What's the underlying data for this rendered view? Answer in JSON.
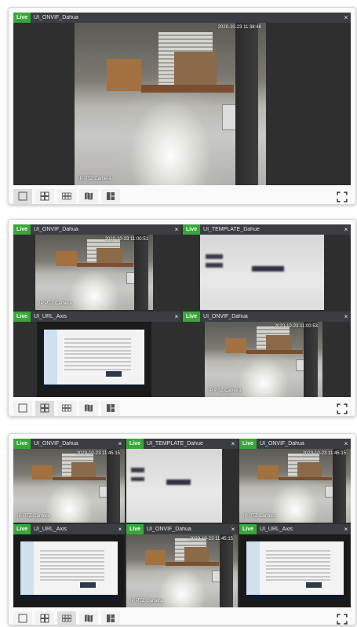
{
  "panels": [
    {
      "tiles": [
        {
          "live": "Live",
          "title": "UI_ONVIF_Dahua",
          "close": "×",
          "timestamp": "2020-10-23 11:38:48",
          "caption": "IP PTZ Camera"
        }
      ]
    },
    {
      "tiles": [
        {
          "live": "Live",
          "title": "UI_ONVIF_Dahua",
          "close": "×",
          "timestamp": "2020-10-23 11:00:51",
          "caption": "IP PTZ Camera"
        },
        {
          "live": "Live",
          "title": "UI_TEMPLATE_Dahue",
          "close": "×",
          "timestamp": "",
          "caption": ""
        },
        {
          "live": "Live",
          "title": "UI_URL_Axis",
          "close": "×",
          "timestamp": "",
          "caption": ""
        },
        {
          "live": "Live",
          "title": "UI_ONVIF_Dahua",
          "close": "×",
          "timestamp": "2020-10-23 11:00:53",
          "caption": "IP PTZ Camera"
        }
      ]
    },
    {
      "tiles": [
        {
          "live": "Live",
          "title": "UI_ONVIF_Dahua",
          "close": "×",
          "timestamp": "2020-10-23 11:45:15",
          "caption": "IP PTZ Camera"
        },
        {
          "live": "Live",
          "title": "UI_TEMPLATE_Dahue",
          "close": "×",
          "timestamp": "",
          "caption": ""
        },
        {
          "live": "Live",
          "title": "UI_ONVIF_Dahua",
          "close": "×",
          "timestamp": "2020-10-23 11:45:15",
          "caption": "IP PTZ Camera"
        },
        {
          "live": "Live",
          "title": "UI_URL_Axis",
          "close": "×",
          "timestamp": "",
          "caption": ""
        },
        {
          "live": "Live",
          "title": "UI_ONVIF_Dahua",
          "close": "×",
          "timestamp": "2020-10-23 11:45:15",
          "caption": "IP PTZ Camera"
        },
        {
          "live": "Live",
          "title": "UI_URL_Axis",
          "close": "×",
          "timestamp": "",
          "caption": ""
        }
      ]
    }
  ],
  "toolbar": {
    "buttons": [
      {
        "icon": "layout-1x1-icon"
      },
      {
        "icon": "layout-2x2-icon"
      },
      {
        "icon": "layout-3x2-icon"
      },
      {
        "icon": "map-icon"
      },
      {
        "icon": "layout-mixed-icon"
      }
    ],
    "active_by_panel": [
      0,
      1,
      2
    ],
    "fullscreen_icon": "fullscreen-icon"
  },
  "colors": {
    "live_badge": "#3aa63a",
    "tile_header": "#3a3d42",
    "viewport_bg": "#2e2e2e"
  }
}
